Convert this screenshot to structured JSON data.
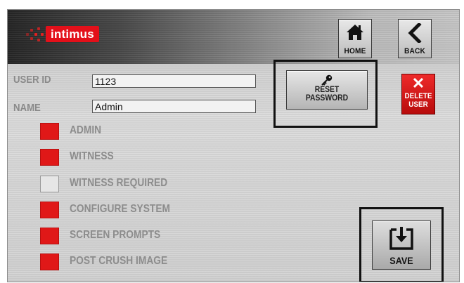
{
  "header": {
    "brand": "intimus",
    "home_label": "HOME",
    "back_label": "BACK",
    "home_icon": "home-icon",
    "back_icon": "chevron-left-icon"
  },
  "user": {
    "user_id_label": "USER ID",
    "user_id_value": "1123",
    "name_label": "NAME",
    "name_value": "Admin"
  },
  "actions": {
    "reset_password_label_line1": "RESET",
    "reset_password_label_line2": "PASSWORD",
    "reset_icon": "key-icon",
    "delete_user_label_line1": "DELETE",
    "delete_user_label_line2": "USER",
    "delete_icon": "x-icon",
    "save_label": "SAVE",
    "save_icon": "save-icon"
  },
  "permissions": [
    {
      "label": "ADMIN",
      "checked": true
    },
    {
      "label": "WITNESS",
      "checked": true
    },
    {
      "label": "WITNESS REQUIRED",
      "checked": false
    },
    {
      "label": "CONFIGURE SYSTEM",
      "checked": true
    },
    {
      "label": "SCREEN PROMPTS",
      "checked": true
    },
    {
      "label": "POST CRUSH IMAGE",
      "checked": true
    }
  ],
  "colors": {
    "accent_red": "#e01818",
    "unchecked": "#e6e6e6",
    "label_gray": "#8c8c8c"
  }
}
